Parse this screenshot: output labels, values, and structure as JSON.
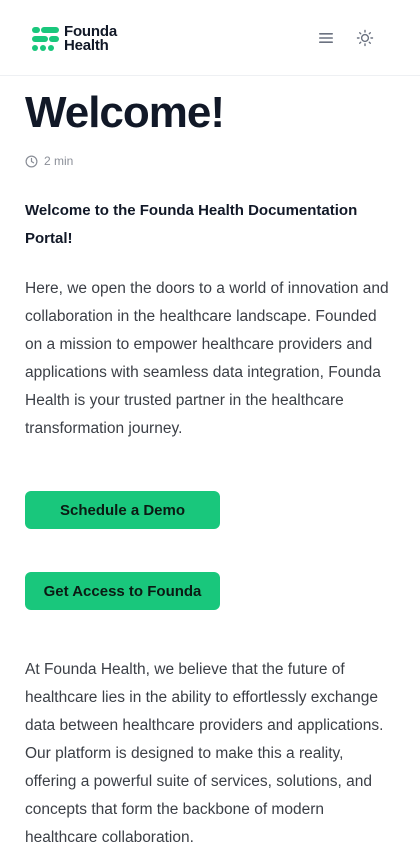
{
  "header": {
    "logo": {
      "line1": "Founda",
      "line2": "Health",
      "brand_color": "#19c77c"
    },
    "menu_icon": "hamburger-menu-icon",
    "theme_icon": "sun-icon"
  },
  "article": {
    "title": "Welcome!",
    "reading_time": "2 min",
    "lead": "Welcome to the Founda Health Documentation Portal!",
    "paragraph1": "Here, we open the doors to a world of innovation and collaboration in the healthcare landscape. Founded on a mission to empower healthcare providers and applications with seamless data integration, Founda Health is your trusted partner in the healthcare transformation journey.",
    "cta_demo": "Schedule a Demo",
    "cta_access": "Get Access to Founda",
    "paragraph2": "At Founda Health, we believe that the future of healthcare lies in the ability to effortlessly exchange data between healthcare providers and applications. Our platform is designed to make this a reality, offering a powerful suite of services, solutions, and concepts that form the backbone of modern healthcare collaboration."
  },
  "colors": {
    "accent": "#19c77c",
    "text": "#111827",
    "muted": "#8b8f98",
    "body": "#3b3f46"
  }
}
